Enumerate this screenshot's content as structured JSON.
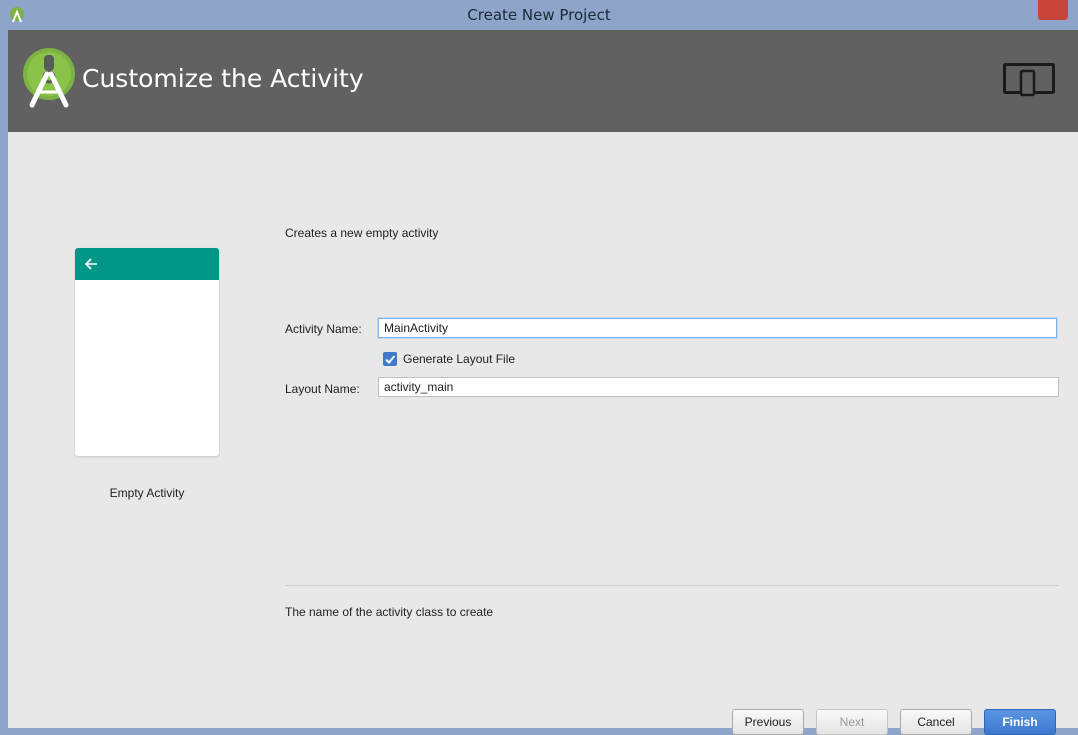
{
  "window": {
    "title": "Create New Project"
  },
  "header": {
    "title": "Customize the Activity"
  },
  "preview": {
    "label": "Empty Activity",
    "appbar_color": "#009688"
  },
  "form": {
    "description": "Creates a new empty activity",
    "activity_name_label": "Activity Name:",
    "activity_name_value": "MainActivity",
    "generate_layout_label": "Generate Layout File",
    "generate_layout_checked": true,
    "layout_name_label": "Layout Name:",
    "layout_name_value": "activity_main"
  },
  "help": {
    "text": "The name of the activity class to create"
  },
  "buttons": {
    "previous": "Previous",
    "next": "Next",
    "cancel": "Cancel",
    "finish": "Finish"
  },
  "colors": {
    "titlebar": "#8ea4c8",
    "banner": "#616161",
    "accent_blue": "#3d78cf",
    "close_red": "#c9453b",
    "android_green": "#7cb342"
  },
  "icons": {
    "app": "android-studio-icon",
    "logo": "android-studio-logo",
    "device": "device-form-factor-icon",
    "back": "back-arrow-icon",
    "check": "checkmark-icon"
  }
}
